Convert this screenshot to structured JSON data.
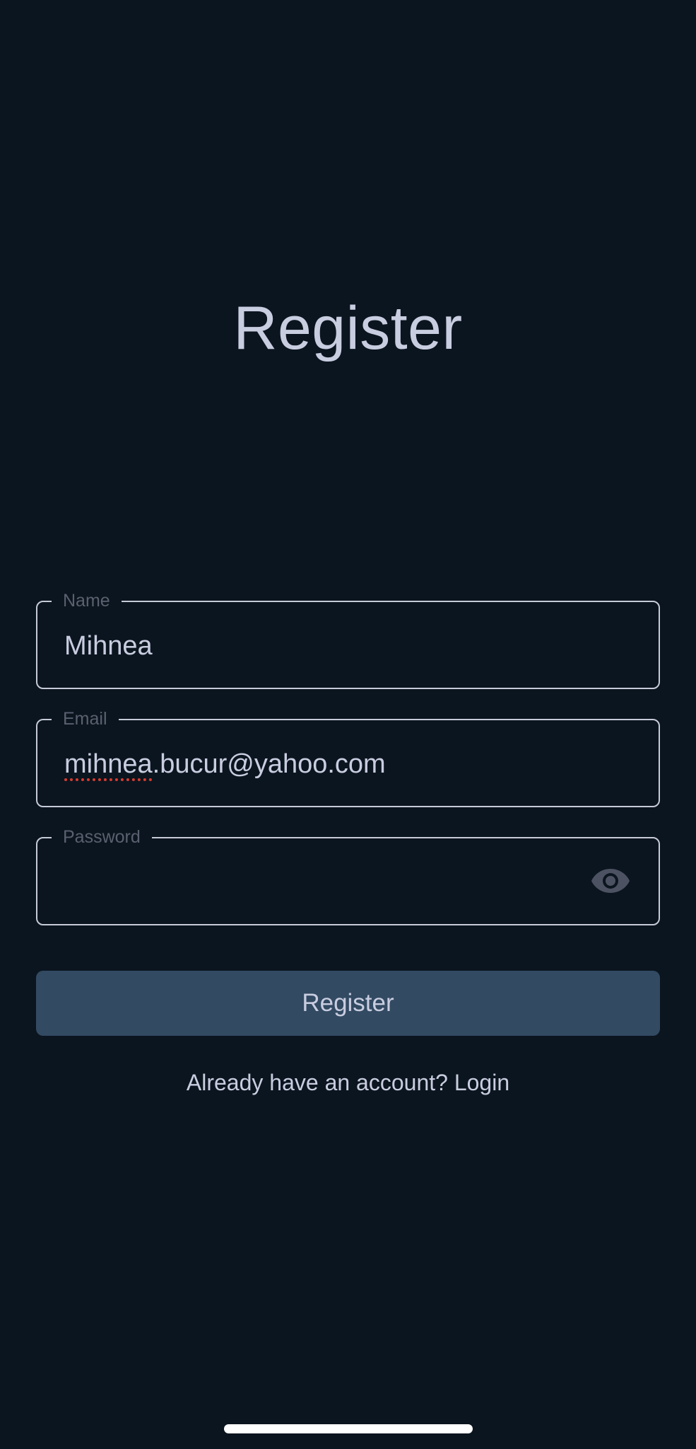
{
  "title": "Register",
  "form": {
    "name": {
      "label": "Name",
      "value": "Mihnea"
    },
    "email": {
      "label": "Email",
      "value_misspelled_part": "mihnea",
      "value_rest": ".bucur@yahoo.com"
    },
    "password": {
      "label": "Password",
      "value": "",
      "toggle_icon": "eye-icon"
    },
    "submit_label": "Register"
  },
  "login_prompt": "Already have an account? Login",
  "colors": {
    "background": "#0b151f",
    "text": "#c9cde0",
    "label": "#5a606f",
    "button": "#324a62",
    "spellcheck": "#d93b2f"
  }
}
